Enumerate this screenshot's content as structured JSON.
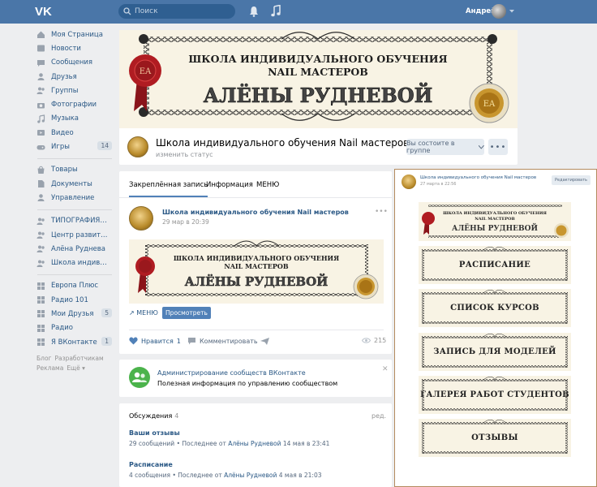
{
  "header": {
    "search_placeholder": "Поиск",
    "user_name": "Андрей"
  },
  "sidebar": {
    "items": [
      {
        "label": "Моя Страница",
        "icon": "home-icon"
      },
      {
        "label": "Новости",
        "icon": "news-icon"
      },
      {
        "label": "Сообщения",
        "icon": "messages-icon"
      },
      {
        "label": "Друзья",
        "icon": "friends-icon"
      },
      {
        "label": "Группы",
        "icon": "groups-icon"
      },
      {
        "label": "Фотографии",
        "icon": "camera-icon"
      },
      {
        "label": "Музыка",
        "icon": "music-icon"
      },
      {
        "label": "Видео",
        "icon": "video-icon"
      },
      {
        "label": "Игры",
        "icon": "games-icon",
        "count": "14"
      }
    ],
    "items2": [
      {
        "label": "Товары",
        "icon": "goods-icon"
      },
      {
        "label": "Документы",
        "icon": "documents-icon"
      },
      {
        "label": "Управление",
        "icon": "management-icon"
      }
    ],
    "items3": [
      {
        "label": "ТИПОГРАФИЯ | ДИ...",
        "icon": "group-icon"
      },
      {
        "label": "Центр развития...",
        "icon": "group-icon"
      },
      {
        "label": "Алёна Руднева",
        "icon": "group-icon"
      },
      {
        "label": "Школа индивидуа...",
        "icon": "group-icon"
      }
    ],
    "items4": [
      {
        "label": "Европа Плюс",
        "icon": "app-icon"
      },
      {
        "label": "Радио 101",
        "icon": "app-icon"
      },
      {
        "label": "Мои Друзья",
        "icon": "app-icon",
        "count": "5"
      },
      {
        "label": "Радио",
        "icon": "app-icon"
      },
      {
        "label": "Я ВКонтакте",
        "icon": "app-icon",
        "count": "1"
      }
    ],
    "footer": {
      "blog": "Блог",
      "developers": "Разработчикам",
      "ads": "Реклама",
      "more": "Ещё ▾"
    }
  },
  "banner": {
    "line1": "ШКОЛА ИНДИВИДУАЛЬНОГО ОБУЧЕНИЯ",
    "line2": "NAIL МАСТЕРОВ",
    "line3": "АЛЁНЫ РУДНЕВОЙ"
  },
  "group": {
    "name": "Школа индивидуального обучения Nail мастеров",
    "status": "изменить статус",
    "member_button": "Вы состоите в группе",
    "more_button": "•••"
  },
  "wall": {
    "tabs": [
      "Закреплённая запись",
      "Информация",
      "МЕНЮ"
    ],
    "post": {
      "author": "Школа индивидуального обучения Nail мастеров",
      "date": "29 мар в 20:39",
      "dots": "•••",
      "menu_link": "МЕНЮ",
      "view_button": "Просмотреть",
      "like_label": "Нравится",
      "like_count": "1",
      "comment_label": "Комментировать",
      "views": "215"
    }
  },
  "admin": {
    "title": "Администрирование сообществ ВКонтакте",
    "text": "Полезная информация по управлению сообществом",
    "close": "✕"
  },
  "discussions": {
    "header": "Обсуждения",
    "count": "4",
    "edit": "ред.",
    "topics": [
      {
        "title": "Ваши отзывы",
        "count": "29 сообщений",
        "sep": "•",
        "last_prefix": "Последнее от",
        "author": "Алёны Рудневой",
        "time": "14 мая в 23:41"
      },
      {
        "title": "Расписание",
        "count": "4 сообщения",
        "sep": "•",
        "last_prefix": "Последнее от",
        "author": "Алёны Рудневой",
        "time": "4 мая в 21:03"
      }
    ]
  },
  "overlay": {
    "name": "Школа индивидуального обучения Nail мастеров",
    "date": "27 марта в 22:56",
    "edit": "Редактировать",
    "banner": {
      "line1": "ШКОЛА ИНДИВИДУАЛЬНОГО ОБУЧЕНИЯ",
      "line2": "NAIL МАСТЕРОВ",
      "line3": "АЛЁНЫ РУДНЕВОЙ"
    },
    "buttons": [
      "РАСПИСАНИЕ",
      "СПИСОК КУРСОВ",
      "ЗАПИСЬ ДЛЯ МОДЕЛЕЙ",
      "ГАЛЕРЕЯ РАБОТ СТУДЕНТОВ",
      "ОТЗЫВЫ"
    ]
  },
  "colors": {
    "topbar": "#4a76a8",
    "link": "#2a5885",
    "primary_button": "#5181b8",
    "cover_bg": "#f8f3e4",
    "seal_red": "#b01c22"
  }
}
